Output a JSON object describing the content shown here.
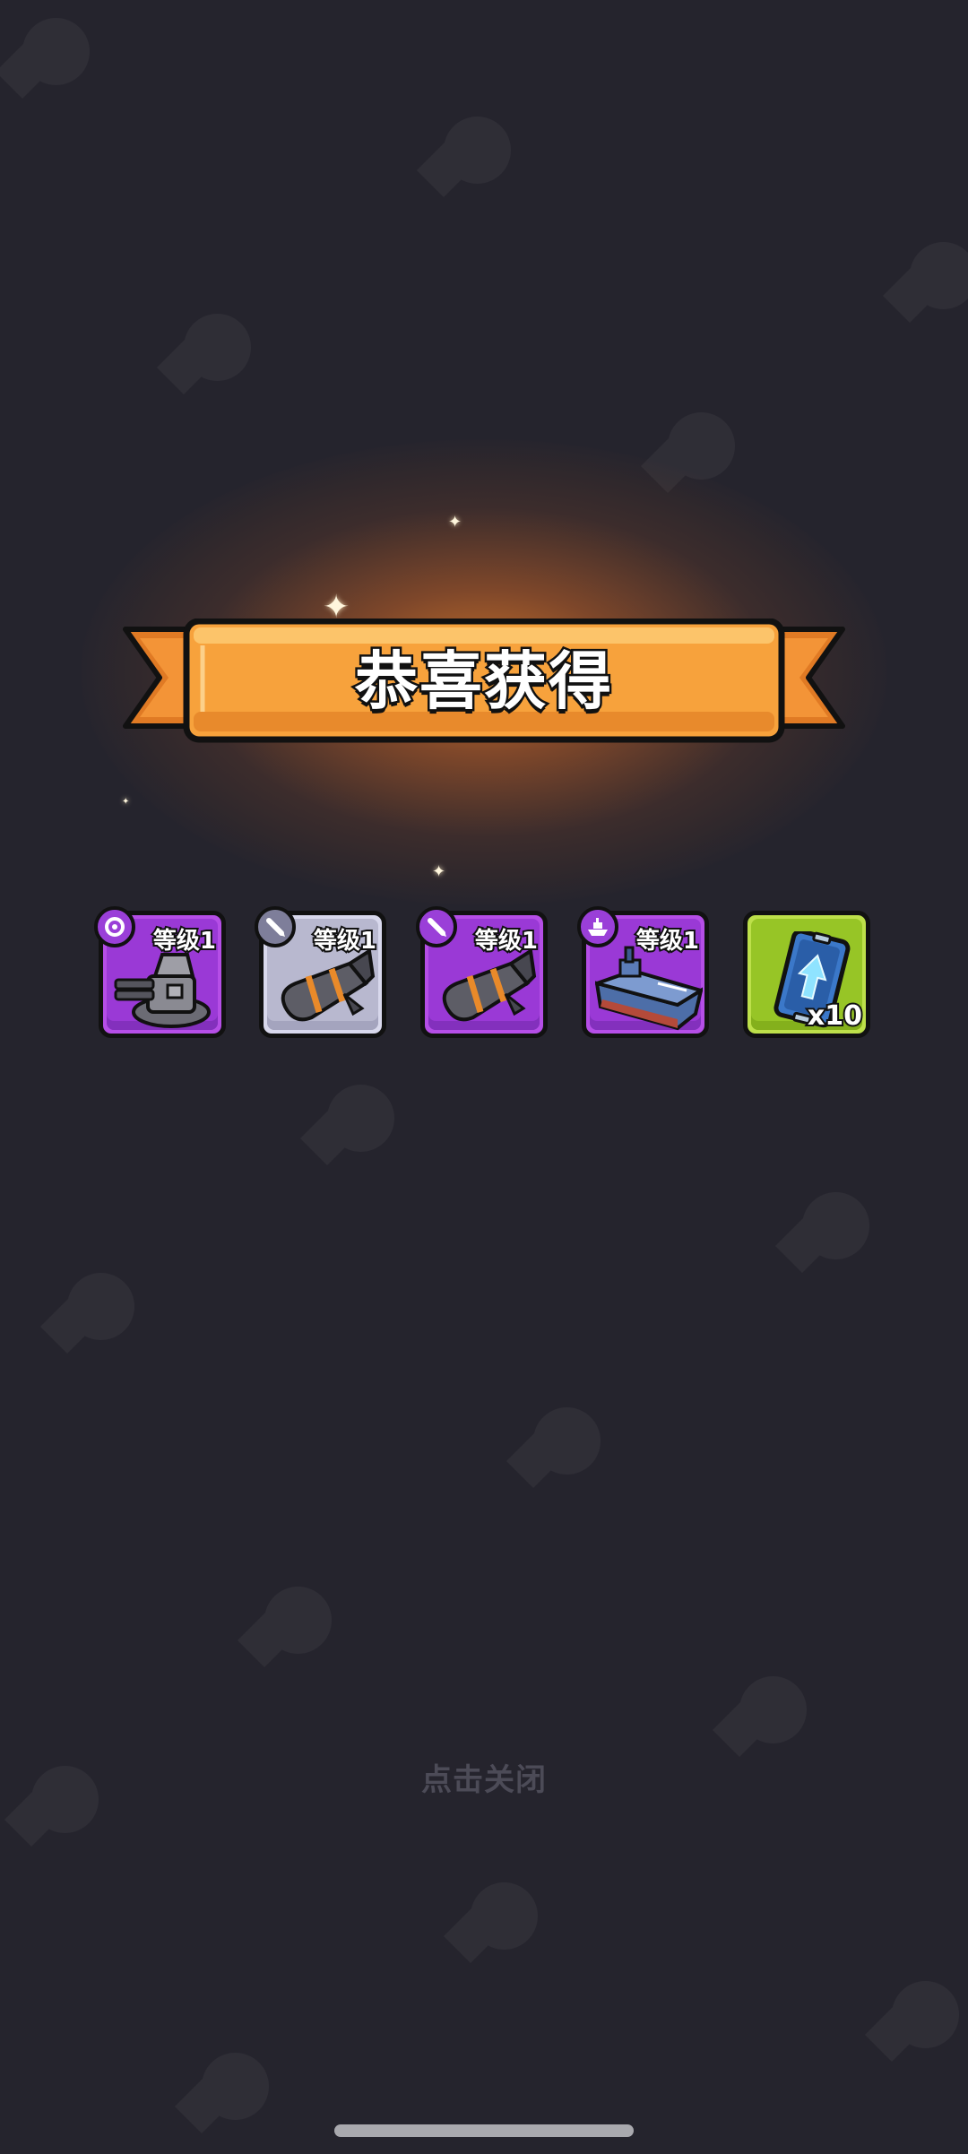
{
  "popup": {
    "title": "恭喜获得",
    "close_hint": "点击关闭"
  },
  "rewards": [
    {
      "name": "turret",
      "level_label": "等级1",
      "rarity": "purple",
      "badge_icon": "gear-icon"
    },
    {
      "name": "missile",
      "level_label": "等级1",
      "rarity": "gray",
      "badge_icon": "missile-icon"
    },
    {
      "name": "missile",
      "level_label": "等级1",
      "rarity": "purple",
      "badge_icon": "missile-icon"
    },
    {
      "name": "battleship",
      "level_label": "等级1",
      "rarity": "purple",
      "badge_icon": "ship-icon"
    },
    {
      "name": "upgrade-card",
      "quantity": "x10",
      "rarity": "green"
    }
  ],
  "colors": {
    "background": "#25242d",
    "ribbon": "#f7a23c",
    "purple_card": "#9a39d6",
    "gray_card": "#b8b8cf",
    "green_card": "#97c526"
  }
}
